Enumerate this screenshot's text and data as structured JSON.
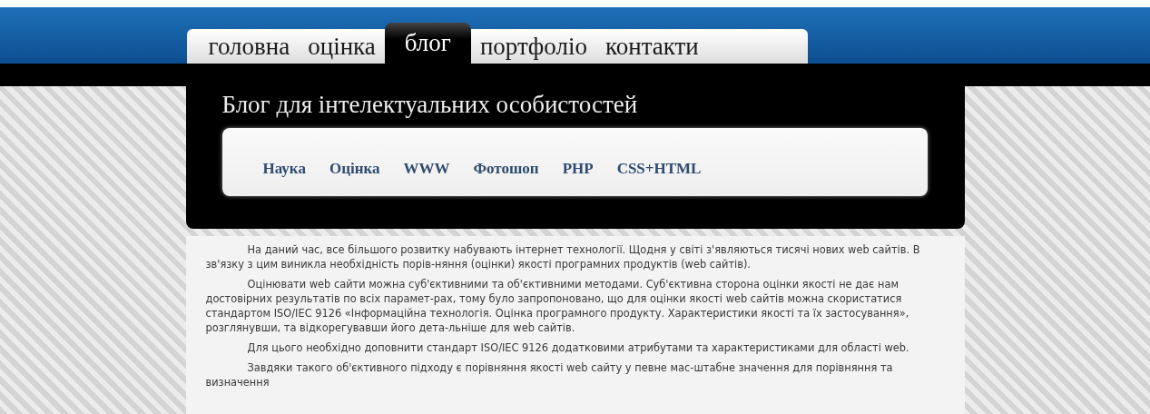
{
  "tabs": [
    {
      "label": "головна",
      "selected": false
    },
    {
      "label": "оцінка",
      "selected": false
    },
    {
      "label": "блог",
      "selected": true
    },
    {
      "label": "портфоліо",
      "selected": false
    },
    {
      "label": "контакти",
      "selected": false
    }
  ],
  "header": {
    "title": "Блог для інтелектуальних особистостей"
  },
  "categories": [
    "Наука",
    "Оцінка",
    "WWW",
    "Фотошоп",
    "PHP",
    "CSS+HTML"
  ],
  "article": {
    "paragraphs": [
      "На даний час, все більшого розвитку набувають інтернет технології. Щодня у світі з'являються тисячі нових web сайтів. В зв'язку з цим виникла необхідність порів-няння (оцінки) якості програмних продуктів (web сайтів).",
      "Оцінювати web сайти можна суб'єктивними та об'єктивними методами. Суб'єктивна сторона оцінки якості не дає нам достовірних результатів по всіх парамет-рах, тому було запропоновано, що для оцінки якості web сайтів можна скористатися стандартом ISO/IEC 9126 «Інформаційна технологія. Оцінка програмного продукту. Характеристики якості та їх застосування», розглянувши, та відкорегувавши його дета-льніше для web сайтів.",
      "Для цього необхідно доповнити стандарт ISO/IEC 9126 додатковими атрибутами та характеристиками для області web.",
      "Завдяки такого об'єктивного підходу є порівняння якості web сайту у певне мас-штабне значення для порівняння та визначення"
    ]
  }
}
